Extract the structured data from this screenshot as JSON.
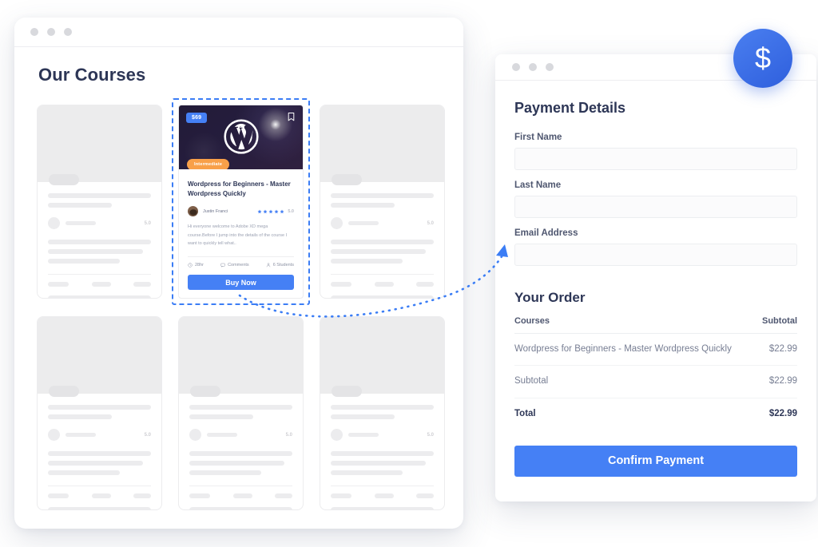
{
  "courses_window": {
    "title": "Our Courses",
    "traffic_lights": [
      "red",
      "yellow",
      "green"
    ],
    "featured_card": {
      "price_badge": "$69",
      "level_tag": "Intermediate",
      "title": "Wordpress for Beginners - Master Wordpress Quickly",
      "author": "Justin Franci",
      "rating": "5.0",
      "stars": 5,
      "description": "Hi everyone welcome to Adobe XD  mega course.Before I jump into the  details of the course I want to quickly tell what..",
      "duration": "28hr",
      "comments": "Comments",
      "students": "6 Students",
      "buy_label": "Buy Now",
      "logo": "wordpress-logo",
      "bookmark": "bookmark-icon"
    },
    "skeleton_rating": "5.0",
    "skeleton_card_count": 5
  },
  "payment_window": {
    "traffic_lights": [
      "red",
      "yellow",
      "green"
    ],
    "heading": "Payment Details",
    "fields": [
      {
        "label": "First Name",
        "value": "",
        "placeholder": ""
      },
      {
        "label": "Last Name",
        "value": "",
        "placeholder": ""
      },
      {
        "label": "Email Address",
        "value": "",
        "placeholder": ""
      }
    ],
    "order": {
      "heading": "Your Order",
      "columns": [
        "Courses",
        "Subtotal"
      ],
      "rows": [
        {
          "label": "Wordpress for Beginners - Master Wordpress Quickly",
          "amount": "$22.99"
        },
        {
          "label": "Subtotal",
          "amount": "$22.99"
        }
      ],
      "total": {
        "label": "Total",
        "amount": "$22.99"
      }
    },
    "confirm_label": "Confirm Payment"
  },
  "badge": {
    "icon": "dollar-sign-icon",
    "symbol": "$"
  },
  "colors": {
    "accent": "#4580f5",
    "badge_gradient_start": "#4a7ff0",
    "badge_gradient_end": "#2f5fdd",
    "level_tag": "#f8a049",
    "heading": "#2d3656",
    "body_text": "#777e93",
    "skeleton": "#ececee",
    "selection_outline": "#3b7df5",
    "thumb_dark": "#221b38"
  }
}
